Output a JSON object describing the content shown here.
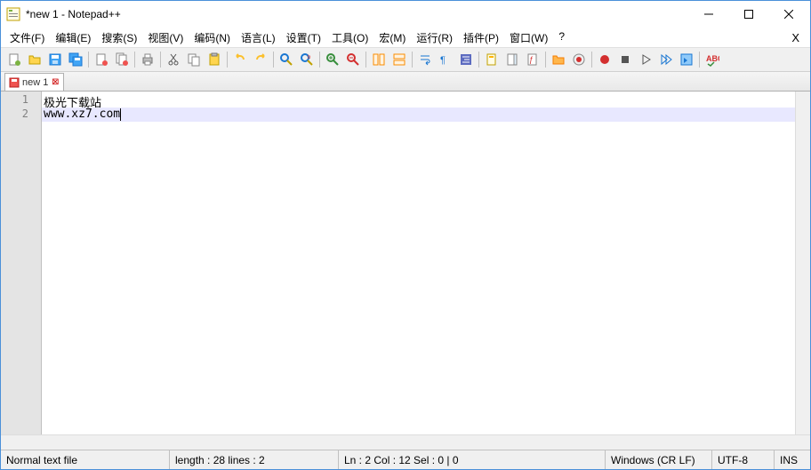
{
  "title": "*new 1 - Notepad++",
  "menus": [
    "文件(F)",
    "编辑(E)",
    "搜索(S)",
    "视图(V)",
    "编码(N)",
    "语言(L)",
    "设置(T)",
    "工具(O)",
    "宏(M)",
    "运行(R)",
    "插件(P)",
    "窗口(W)",
    "?"
  ],
  "tab": {
    "label": "new 1"
  },
  "lines": [
    "极光下载站",
    "www.xz7.com"
  ],
  "status": {
    "filetype": "Normal text file",
    "length": "length : 28    lines : 2",
    "pos": "Ln : 2    Col : 12    Sel : 0 | 0",
    "eol": "Windows (CR LF)",
    "encoding": "UTF-8",
    "mode": "INS"
  }
}
